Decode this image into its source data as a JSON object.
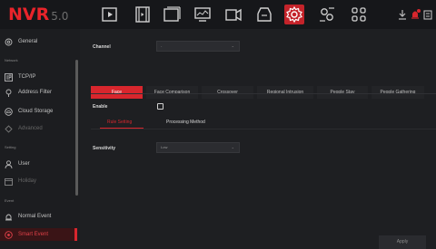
{
  "header": {
    "logo_text": "NVR",
    "logo_version": "5.0",
    "icons": [
      "playback-icon",
      "video-clips-icon",
      "files-icon",
      "monitor-icon",
      "camera-icon",
      "backup-icon",
      "settings-gear-icon",
      "system-config-icon",
      "apps-grid-icon"
    ],
    "active_icon": "settings-gear-icon",
    "right_icons": [
      "download-icon",
      "alarm-icon",
      "lock-icon"
    ]
  },
  "sidebar": {
    "items": [
      {
        "type": "item",
        "label": "General",
        "icon": "gear-icon"
      },
      {
        "type": "section",
        "label": "Network"
      },
      {
        "type": "item",
        "label": "TCP/IP",
        "icon": "ip-icon"
      },
      {
        "type": "item",
        "label": "Address Filter",
        "icon": "pin-icon"
      },
      {
        "type": "item",
        "label": "Cloud Storage",
        "icon": "cloud-icon"
      },
      {
        "type": "item",
        "label": "Advanced",
        "icon": "advanced-icon",
        "dim": true
      },
      {
        "type": "section",
        "label": "Setting"
      },
      {
        "type": "item",
        "label": "User",
        "icon": "user-icon"
      },
      {
        "type": "item",
        "label": "Holiday",
        "icon": "calendar-icon",
        "dim": true
      },
      {
        "type": "section",
        "label": "Event"
      },
      {
        "type": "item",
        "label": "Normal Event",
        "icon": "alarm-event-icon"
      },
      {
        "type": "item",
        "label": "Smart Event",
        "icon": "smart-event-icon",
        "active": true
      }
    ]
  },
  "main": {
    "channel_label": "Channel",
    "channel_value": "-",
    "tabs": [
      {
        "label": "Face",
        "active": true
      },
      {
        "label": "Face Comparison"
      },
      {
        "label": "Crossover"
      },
      {
        "label": "Regional Intrusion"
      },
      {
        "label": "People Stay"
      },
      {
        "label": "People Gathering"
      }
    ],
    "enable_label": "Enable",
    "enable_checked": false,
    "subtabs": [
      {
        "label": "Rule Setting",
        "active": true
      },
      {
        "label": "Processing Method"
      }
    ],
    "sensitivity_label": "Sensitivity",
    "sensitivity_value": "Low",
    "apply_label": "Apply"
  },
  "colors": {
    "accent": "#d8262d",
    "background": "#1e1f22",
    "sidebar_bg": "#1c1d20",
    "topbar_bg": "#16171a"
  }
}
